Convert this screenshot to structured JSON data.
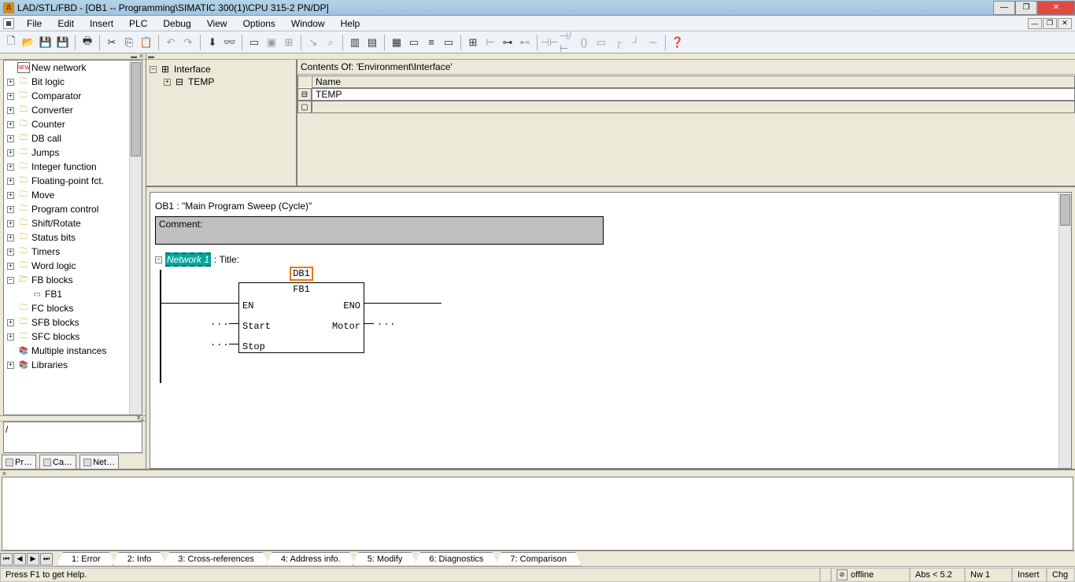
{
  "title": "LAD/STL/FBD  - [OB1 -- Programming\\SIMATIC 300(1)\\CPU 315-2 PN/DP]",
  "menu": {
    "file": "File",
    "edit": "Edit",
    "insert": "Insert",
    "plc": "PLC",
    "debug": "Debug",
    "view": "View",
    "options": "Options",
    "window": "Window",
    "help": "Help"
  },
  "catalog": {
    "newnet": "New network",
    "bitlogic": "Bit logic",
    "comparator": "Comparator",
    "converter": "Converter",
    "counter": "Counter",
    "dbcall": "DB call",
    "jumps": "Jumps",
    "intfn": "Integer function",
    "floatfn": "Floating-point fct.",
    "move": "Move",
    "progctrl": "Program control",
    "shift": "Shift/Rotate",
    "status": "Status bits",
    "timers": "Timers",
    "wordlogic": "Word logic",
    "fbblocks": "FB blocks",
    "fb1": "FB1",
    "fcblocks": "FC blocks",
    "sfbblocks": "SFB blocks",
    "sfcblocks": "SFC blocks",
    "multi": "Multiple instances",
    "libs": "Libraries"
  },
  "lp_input": "/",
  "lp_tabs": {
    "pr": "Pr…",
    "ca": "Ca…",
    "net": "Net…"
  },
  "iface": {
    "root": "Interface",
    "temp": "TEMP",
    "contents": "Contents Of: 'Environment\\Interface'",
    "namecol": "Name",
    "row_temp": "TEMP"
  },
  "editor": {
    "ob_line": "OB1 :  \"Main Program Sweep (Cycle)\"",
    "comment_label": "Comment:",
    "network": "Network 1",
    "network_suffix": ": Title:",
    "db": "DB1",
    "block": "FB1",
    "pins": {
      "en": "EN",
      "eno": "ENO",
      "start": "Start",
      "motor": "Motor",
      "stop": "Stop"
    },
    "dots": "..."
  },
  "bp_tabs": {
    "t1": "1: Error",
    "t2": "2: Info",
    "t3": "3: Cross-references",
    "t4": "4: Address info.",
    "t5": "5: Modify",
    "t6": "6: Diagnostics",
    "t7": "7: Comparison"
  },
  "status": {
    "help": "Press F1 to get Help.",
    "offline": "offline",
    "abs": "Abs < 5.2",
    "nw": "Nw 1",
    "insert": "Insert",
    "chg": "Chg"
  }
}
